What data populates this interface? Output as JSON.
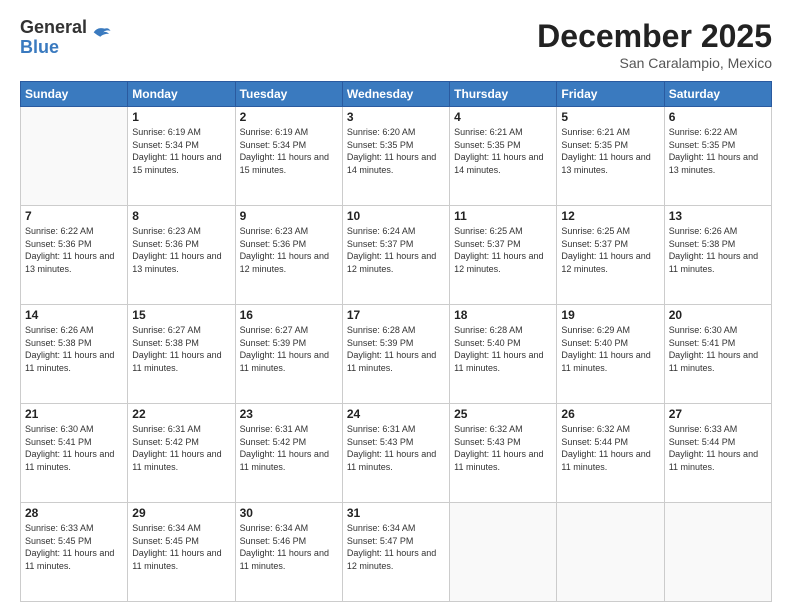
{
  "header": {
    "logo_general": "General",
    "logo_blue": "Blue",
    "month_title": "December 2025",
    "location": "San Caralampio, Mexico"
  },
  "weekdays": [
    "Sunday",
    "Monday",
    "Tuesday",
    "Wednesday",
    "Thursday",
    "Friday",
    "Saturday"
  ],
  "weeks": [
    [
      {
        "day": "",
        "empty": true
      },
      {
        "day": "1",
        "sunrise": "Sunrise: 6:19 AM",
        "sunset": "Sunset: 5:34 PM",
        "daylight": "Daylight: 11 hours and 15 minutes."
      },
      {
        "day": "2",
        "sunrise": "Sunrise: 6:19 AM",
        "sunset": "Sunset: 5:34 PM",
        "daylight": "Daylight: 11 hours and 15 minutes."
      },
      {
        "day": "3",
        "sunrise": "Sunrise: 6:20 AM",
        "sunset": "Sunset: 5:35 PM",
        "daylight": "Daylight: 11 hours and 14 minutes."
      },
      {
        "day": "4",
        "sunrise": "Sunrise: 6:21 AM",
        "sunset": "Sunset: 5:35 PM",
        "daylight": "Daylight: 11 hours and 14 minutes."
      },
      {
        "day": "5",
        "sunrise": "Sunrise: 6:21 AM",
        "sunset": "Sunset: 5:35 PM",
        "daylight": "Daylight: 11 hours and 13 minutes."
      },
      {
        "day": "6",
        "sunrise": "Sunrise: 6:22 AM",
        "sunset": "Sunset: 5:35 PM",
        "daylight": "Daylight: 11 hours and 13 minutes."
      }
    ],
    [
      {
        "day": "7",
        "sunrise": "Sunrise: 6:22 AM",
        "sunset": "Sunset: 5:36 PM",
        "daylight": "Daylight: 11 hours and 13 minutes."
      },
      {
        "day": "8",
        "sunrise": "Sunrise: 6:23 AM",
        "sunset": "Sunset: 5:36 PM",
        "daylight": "Daylight: 11 hours and 13 minutes."
      },
      {
        "day": "9",
        "sunrise": "Sunrise: 6:23 AM",
        "sunset": "Sunset: 5:36 PM",
        "daylight": "Daylight: 11 hours and 12 minutes."
      },
      {
        "day": "10",
        "sunrise": "Sunrise: 6:24 AM",
        "sunset": "Sunset: 5:37 PM",
        "daylight": "Daylight: 11 hours and 12 minutes."
      },
      {
        "day": "11",
        "sunrise": "Sunrise: 6:25 AM",
        "sunset": "Sunset: 5:37 PM",
        "daylight": "Daylight: 11 hours and 12 minutes."
      },
      {
        "day": "12",
        "sunrise": "Sunrise: 6:25 AM",
        "sunset": "Sunset: 5:37 PM",
        "daylight": "Daylight: 11 hours and 12 minutes."
      },
      {
        "day": "13",
        "sunrise": "Sunrise: 6:26 AM",
        "sunset": "Sunset: 5:38 PM",
        "daylight": "Daylight: 11 hours and 11 minutes."
      }
    ],
    [
      {
        "day": "14",
        "sunrise": "Sunrise: 6:26 AM",
        "sunset": "Sunset: 5:38 PM",
        "daylight": "Daylight: 11 hours and 11 minutes."
      },
      {
        "day": "15",
        "sunrise": "Sunrise: 6:27 AM",
        "sunset": "Sunset: 5:38 PM",
        "daylight": "Daylight: 11 hours and 11 minutes."
      },
      {
        "day": "16",
        "sunrise": "Sunrise: 6:27 AM",
        "sunset": "Sunset: 5:39 PM",
        "daylight": "Daylight: 11 hours and 11 minutes."
      },
      {
        "day": "17",
        "sunrise": "Sunrise: 6:28 AM",
        "sunset": "Sunset: 5:39 PM",
        "daylight": "Daylight: 11 hours and 11 minutes."
      },
      {
        "day": "18",
        "sunrise": "Sunrise: 6:28 AM",
        "sunset": "Sunset: 5:40 PM",
        "daylight": "Daylight: 11 hours and 11 minutes."
      },
      {
        "day": "19",
        "sunrise": "Sunrise: 6:29 AM",
        "sunset": "Sunset: 5:40 PM",
        "daylight": "Daylight: 11 hours and 11 minutes."
      },
      {
        "day": "20",
        "sunrise": "Sunrise: 6:30 AM",
        "sunset": "Sunset: 5:41 PM",
        "daylight": "Daylight: 11 hours and 11 minutes."
      }
    ],
    [
      {
        "day": "21",
        "sunrise": "Sunrise: 6:30 AM",
        "sunset": "Sunset: 5:41 PM",
        "daylight": "Daylight: 11 hours and 11 minutes."
      },
      {
        "day": "22",
        "sunrise": "Sunrise: 6:31 AM",
        "sunset": "Sunset: 5:42 PM",
        "daylight": "Daylight: 11 hours and 11 minutes."
      },
      {
        "day": "23",
        "sunrise": "Sunrise: 6:31 AM",
        "sunset": "Sunset: 5:42 PM",
        "daylight": "Daylight: 11 hours and 11 minutes."
      },
      {
        "day": "24",
        "sunrise": "Sunrise: 6:31 AM",
        "sunset": "Sunset: 5:43 PM",
        "daylight": "Daylight: 11 hours and 11 minutes."
      },
      {
        "day": "25",
        "sunrise": "Sunrise: 6:32 AM",
        "sunset": "Sunset: 5:43 PM",
        "daylight": "Daylight: 11 hours and 11 minutes."
      },
      {
        "day": "26",
        "sunrise": "Sunrise: 6:32 AM",
        "sunset": "Sunset: 5:44 PM",
        "daylight": "Daylight: 11 hours and 11 minutes."
      },
      {
        "day": "27",
        "sunrise": "Sunrise: 6:33 AM",
        "sunset": "Sunset: 5:44 PM",
        "daylight": "Daylight: 11 hours and 11 minutes."
      }
    ],
    [
      {
        "day": "28",
        "sunrise": "Sunrise: 6:33 AM",
        "sunset": "Sunset: 5:45 PM",
        "daylight": "Daylight: 11 hours and 11 minutes."
      },
      {
        "day": "29",
        "sunrise": "Sunrise: 6:34 AM",
        "sunset": "Sunset: 5:45 PM",
        "daylight": "Daylight: 11 hours and 11 minutes."
      },
      {
        "day": "30",
        "sunrise": "Sunrise: 6:34 AM",
        "sunset": "Sunset: 5:46 PM",
        "daylight": "Daylight: 11 hours and 11 minutes."
      },
      {
        "day": "31",
        "sunrise": "Sunrise: 6:34 AM",
        "sunset": "Sunset: 5:47 PM",
        "daylight": "Daylight: 11 hours and 12 minutes."
      },
      {
        "day": "",
        "empty": true
      },
      {
        "day": "",
        "empty": true
      },
      {
        "day": "",
        "empty": true
      }
    ]
  ]
}
